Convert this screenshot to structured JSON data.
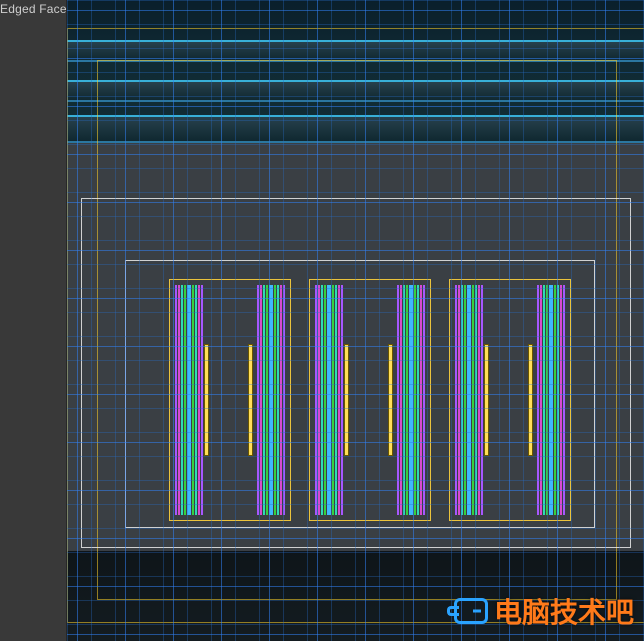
{
  "viewport": {
    "label_suffix": "Edged Faces ]"
  },
  "watermark": {
    "text": "电脑技术吧"
  },
  "colors": {
    "wire_blue": "#3282f5",
    "wire_cyan": "#3fb8ff",
    "wire_green": "#36d23e",
    "wire_teal": "#2edbb6",
    "wire_purple": "#a757ff",
    "wire_magenta": "#d74bcf",
    "selection_yellow": "#ffd23c",
    "handle_yellow": "#ffde59",
    "bg_dark": "#393939"
  },
  "scene": {
    "shading_mode": "Edged Faces",
    "selected": true
  }
}
